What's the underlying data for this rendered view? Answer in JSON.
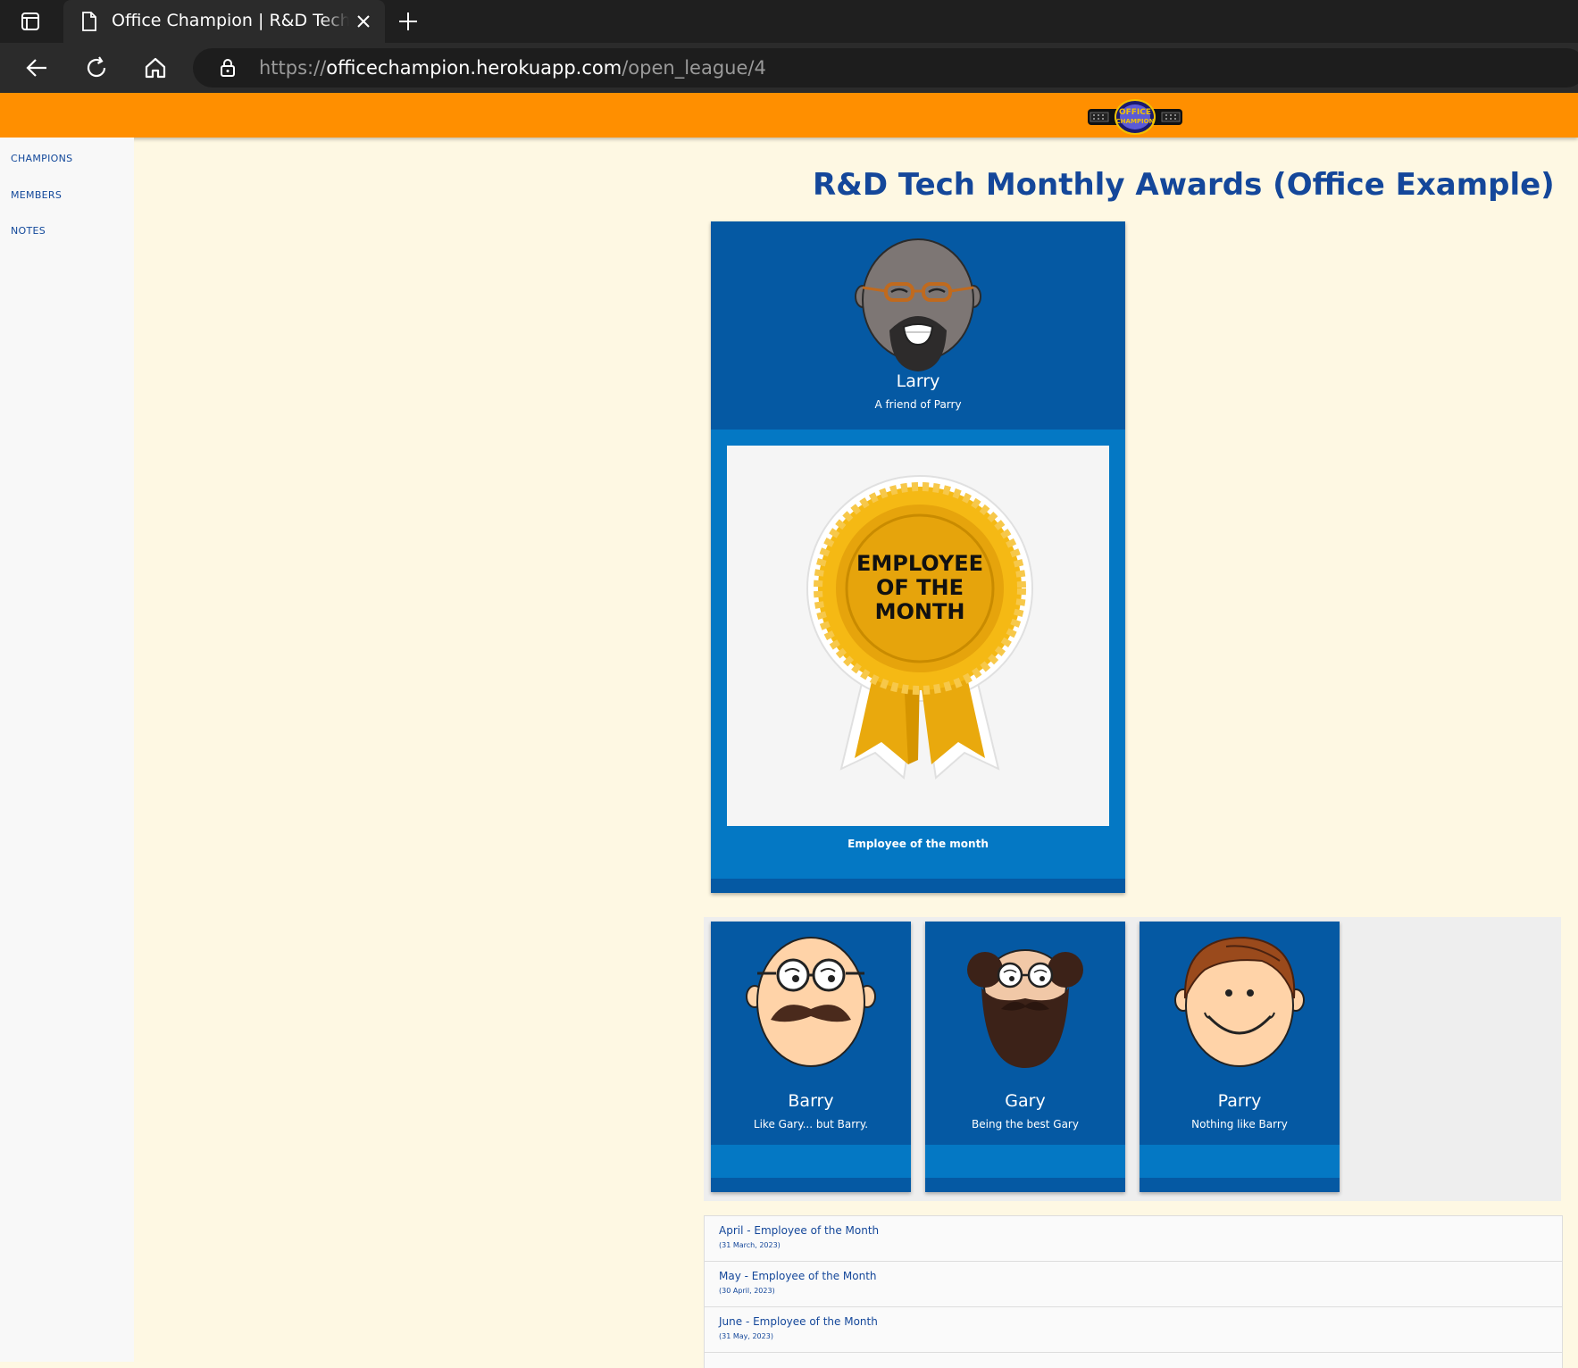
{
  "browser": {
    "tab_title": "Office Champion | R&D Tech Monthly Awards (Office Example)",
    "url_prefix": "https://",
    "url_domain": "officechampion.herokuapp.com",
    "url_path": "/open_league/4"
  },
  "header": {
    "logo_text": "OFFICE CHAMPION",
    "brand_color": "#ff8f00"
  },
  "sidebar": {
    "items": [
      {
        "label": "CHAMPIONS"
      },
      {
        "label": "MEMBERS"
      },
      {
        "label": "NOTES"
      }
    ]
  },
  "page": {
    "title": "R&D Tech Monthly Awards (Office Example)"
  },
  "champion": {
    "name": "Larry",
    "description": "A friend of Parry",
    "award_badge": [
      "EMPLOYEE",
      "OF THE",
      "MONTH"
    ],
    "award_caption": "Employee of the month"
  },
  "members": [
    {
      "name": "Barry",
      "description": "Like Gary... but Barry."
    },
    {
      "name": "Gary",
      "description": "Being the best Gary"
    },
    {
      "name": "Parry",
      "description": "Nothing like Barry"
    }
  ],
  "history": [
    {
      "title": "April - Employee of the Month",
      "date": "(31 March, 2023)"
    },
    {
      "title": "May - Employee of the Month",
      "date": "(30 April, 2023)"
    },
    {
      "title": "June - Employee of the Month",
      "date": "(31 May, 2023)"
    }
  ],
  "colors": {
    "card_dark": "#0559a3",
    "card_light": "#0478c4",
    "title_blue": "#14479a",
    "page_bg": "#fef8e3"
  }
}
